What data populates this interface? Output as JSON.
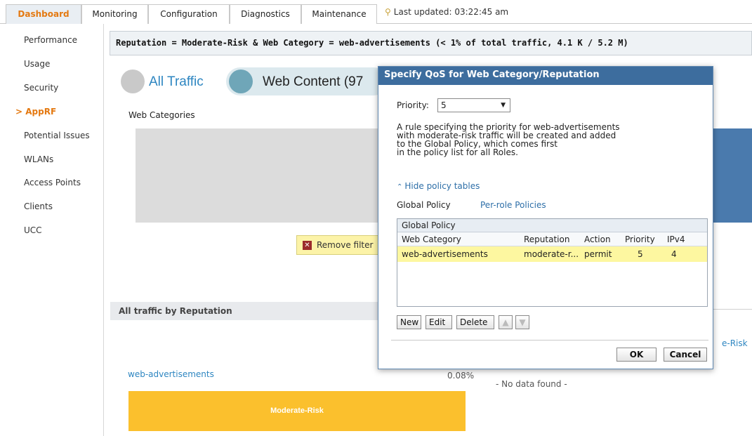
{
  "tabs": [
    {
      "label": "Dashboard",
      "active": true
    },
    {
      "label": "Monitoring"
    },
    {
      "label": "Configuration"
    },
    {
      "label": "Diagnostics"
    },
    {
      "label": "Maintenance"
    }
  ],
  "last_updated": "Last updated: 03:22:45 am",
  "sidebar": {
    "items": [
      {
        "label": "Performance"
      },
      {
        "label": "Usage"
      },
      {
        "label": "Security"
      },
      {
        "label": "> AppRF",
        "active": true
      },
      {
        "label": "Potential Issues"
      },
      {
        "label": "WLANs"
      },
      {
        "label": "Access Points"
      },
      {
        "label": "Clients"
      },
      {
        "label": "UCC"
      }
    ]
  },
  "filter_header": "Reputation = Moderate-Risk & Web Category = web-advertisements (< 1% of total traffic, 4.1 K / 5.2 M)",
  "pills": {
    "all": "All Traffic",
    "web": "Web Content (97"
  },
  "web_categories_label": "Web Categories",
  "remove_filter": "Remove filter",
  "reputation_header": "All traffic by Reputation",
  "risk_edge": "e-Risk",
  "webads_link": "web-advertisements",
  "pct": "0.08%",
  "no_data": "- No data found -",
  "moderate_bar": "Moderate-Risk",
  "colors": {
    "accent_orange": "#e47911",
    "dialog_title": "#3d6d9e",
    "row_highlight": "#fdf7a0",
    "moderate_bar": "#fbc02d"
  },
  "dialog": {
    "title": "Specify QoS for Web Category/Reputation",
    "priority_label": "Priority:",
    "priority_value": "5",
    "description": "A rule specifying the priority for web-advertisements\nwith moderate-risk traffic will be created and added\nto the Global Policy, which comes first\nin the policy list for all Roles.",
    "hide_link": "Hide policy tables",
    "tab_global": "Global Policy",
    "tab_perrole": "Per-role Policies",
    "table": {
      "caption": "Global Policy",
      "columns": [
        "Web Category",
        "Reputation",
        "Action",
        "Priority",
        "IPv4"
      ],
      "rows": [
        [
          "web-advertisements",
          "moderate-r...",
          "permit",
          "5",
          "4"
        ]
      ]
    },
    "buttons": {
      "new": "New",
      "edit": "Edit",
      "delete": "Delete",
      "up": "▲",
      "down": "▼",
      "ok": "OK",
      "cancel": "Cancel"
    }
  }
}
